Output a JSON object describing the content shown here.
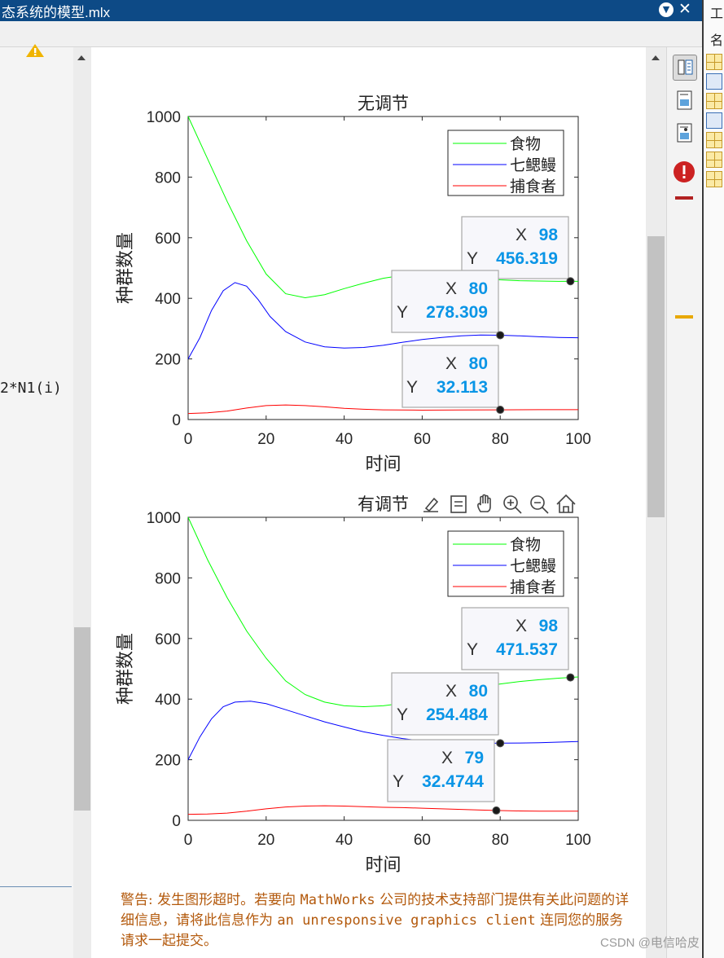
{
  "window": {
    "title": "态系统的模型.mlx"
  },
  "right_panel": {
    "title_char": "工",
    "name_char": "名"
  },
  "code": {
    "line": "2*N1(i)"
  },
  "figure_toolbar": {
    "icons": [
      "export-icon",
      "data-tips-icon",
      "pan-icon",
      "zoom-in-icon",
      "zoom-out-icon",
      "home-icon"
    ]
  },
  "warning": {
    "parts": [
      {
        "text": "警告: 发生图形超时。若要向 ",
        "mono": false
      },
      {
        "text": "MathWorks",
        "mono": true
      },
      {
        "text": " 公司的技术支持部门提供有关此问题的详细信息，请将此信息作为 ",
        "mono": false
      },
      {
        "text": "an unresponsive graphics client",
        "mono": true
      },
      {
        "text": " 连同您的服务请求一起提交。",
        "mono": false
      }
    ]
  },
  "watermark": "CSDN @电信哈皮",
  "colors": {
    "food": "#00ff00",
    "lamprey": "#0000ff",
    "predator": "#ff0000",
    "tip_value": "#0a95e6"
  },
  "chart_data": [
    {
      "type": "line",
      "title": "无调节",
      "xlabel": "时间",
      "ylabel": "种群数量",
      "xlim": [
        0,
        100
      ],
      "ylim": [
        0,
        1000
      ],
      "xticks": [
        0,
        20,
        40,
        60,
        80,
        100
      ],
      "yticks": [
        0,
        200,
        400,
        600,
        800,
        1000
      ],
      "legend_position": "top-right",
      "series": [
        {
          "name": "食物",
          "color": "#00ff00",
          "x": [
            0,
            5,
            10,
            15,
            20,
            25,
            30,
            35,
            40,
            45,
            50,
            55,
            60,
            65,
            70,
            75,
            80,
            85,
            90,
            95,
            98,
            100
          ],
          "y": [
            1000,
            860,
            720,
            590,
            480,
            415,
            402,
            412,
            432,
            450,
            466,
            476,
            480,
            478,
            472,
            466,
            461,
            458,
            457,
            456,
            456.319,
            456
          ]
        },
        {
          "name": "七鳃鳗",
          "color": "#0000ff",
          "x": [
            0,
            3,
            6,
            9,
            12,
            15,
            18,
            21,
            25,
            30,
            35,
            40,
            45,
            50,
            55,
            60,
            65,
            70,
            75,
            80,
            85,
            90,
            95,
            100
          ],
          "y": [
            200,
            270,
            360,
            425,
            452,
            440,
            395,
            340,
            290,
            256,
            240,
            236,
            238,
            245,
            255,
            264,
            271,
            276,
            279,
            278.309,
            276,
            273,
            271,
            270
          ]
        },
        {
          "name": "捕食者",
          "color": "#ff0000",
          "x": [
            0,
            5,
            10,
            15,
            20,
            25,
            30,
            35,
            40,
            45,
            50,
            60,
            70,
            80,
            90,
            100
          ],
          "y": [
            20,
            22,
            28,
            38,
            46,
            48,
            46,
            42,
            37,
            34,
            32,
            31,
            31.5,
            32.113,
            32.5,
            32.5
          ]
        }
      ],
      "datatips": [
        {
          "x": "98",
          "y": "456.319"
        },
        {
          "x": "80",
          "y": "278.309"
        },
        {
          "x": "80",
          "y": "32.113"
        }
      ]
    },
    {
      "type": "line",
      "title": "有调节",
      "xlabel": "时间",
      "ylabel": "种群数量",
      "xlim": [
        0,
        100
      ],
      "ylim": [
        0,
        1000
      ],
      "xticks": [
        0,
        20,
        40,
        60,
        80,
        100
      ],
      "yticks": [
        0,
        200,
        400,
        600,
        800,
        1000
      ],
      "legend_position": "top-right",
      "series": [
        {
          "name": "食物",
          "color": "#00ff00",
          "x": [
            0,
            5,
            10,
            15,
            20,
            25,
            30,
            35,
            40,
            45,
            50,
            55,
            60,
            65,
            70,
            75,
            80,
            85,
            90,
            95,
            98,
            100
          ],
          "y": [
            1000,
            860,
            735,
            625,
            535,
            460,
            415,
            390,
            378,
            375,
            378,
            386,
            400,
            415,
            428,
            440,
            450,
            458,
            464,
            469,
            471.537,
            473
          ]
        },
        {
          "name": "七鳃鳗",
          "color": "#0000ff",
          "x": [
            0,
            3,
            6,
            9,
            12,
            16,
            20,
            25,
            30,
            35,
            40,
            45,
            50,
            55,
            60,
            65,
            70,
            75,
            80,
            85,
            90,
            95,
            100
          ],
          "y": [
            200,
            275,
            335,
            375,
            390,
            393,
            385,
            365,
            345,
            325,
            308,
            292,
            280,
            270,
            262,
            257,
            255,
            254,
            254.484,
            255,
            256,
            258,
            260
          ]
        },
        {
          "name": "捕食者",
          "color": "#ff0000",
          "x": [
            0,
            5,
            10,
            15,
            20,
            25,
            30,
            35,
            40,
            45,
            50,
            55,
            60,
            65,
            70,
            75,
            79,
            85,
            90,
            95,
            100
          ],
          "y": [
            20,
            21,
            24,
            30,
            38,
            44,
            47,
            48,
            47,
            45,
            43,
            42,
            40,
            38,
            36,
            34,
            32.4744,
            31,
            30,
            30,
            30
          ]
        }
      ],
      "datatips": [
        {
          "x": "98",
          "y": "471.537"
        },
        {
          "x": "80",
          "y": "254.484"
        },
        {
          "x": "79",
          "y": "32.4744"
        }
      ]
    }
  ]
}
